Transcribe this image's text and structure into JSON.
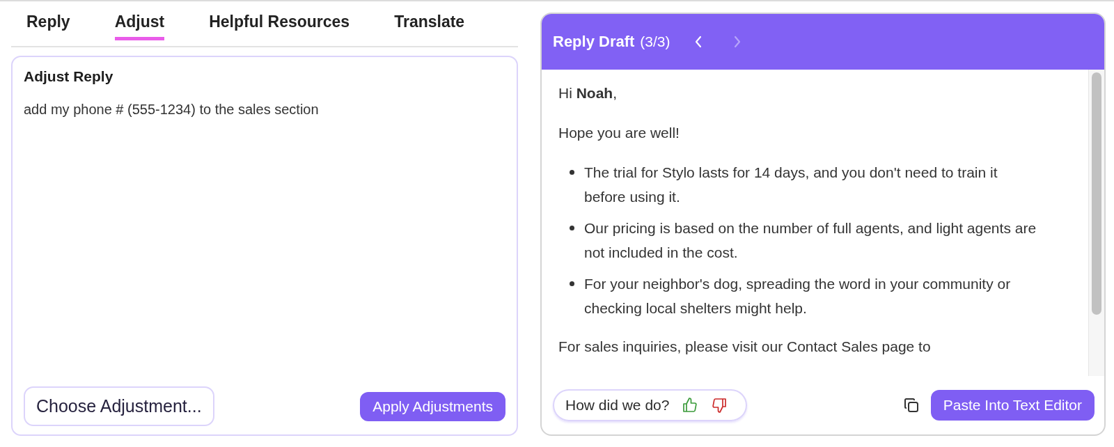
{
  "tabs": [
    {
      "label": "Reply",
      "selected": false
    },
    {
      "label": "Adjust",
      "selected": true
    },
    {
      "label": "Helpful Resources",
      "selected": false
    },
    {
      "label": "Translate",
      "selected": false
    }
  ],
  "adjust_panel": {
    "title": "Adjust Reply",
    "value": "add my phone # (555-1234) to the sales section",
    "choose_button": "Choose Adjustment...",
    "apply_button": "Apply Adjustments"
  },
  "reply_draft": {
    "title": "Reply Draft",
    "counter": "(3/3)",
    "nav": [
      {
        "kind": "prev",
        "disabled": false
      },
      {
        "kind": "next",
        "disabled": true
      }
    ],
    "body": [
      {
        "kind": "paragraph",
        "text": "Hi **Noah**,"
      },
      {
        "kind": "paragraph",
        "text": "Hope you are well!"
      },
      {
        "kind": "bullets",
        "items": [
          "The trial for Stylo lasts for 14 days, and you don't need to train it before using it.",
          "Our pricing is based on the number of full agents, and light agents are not included in the cost.",
          "For your neighbor's dog, spreading the word in your community or checking local shelters might help."
        ]
      },
      {
        "kind": "paragraph",
        "text": "For sales inquiries, please visit our Contact Sales page to"
      }
    ],
    "feedback": {
      "label": "How did we do?"
    },
    "paste_button": "Paste Into Text Editor"
  }
}
